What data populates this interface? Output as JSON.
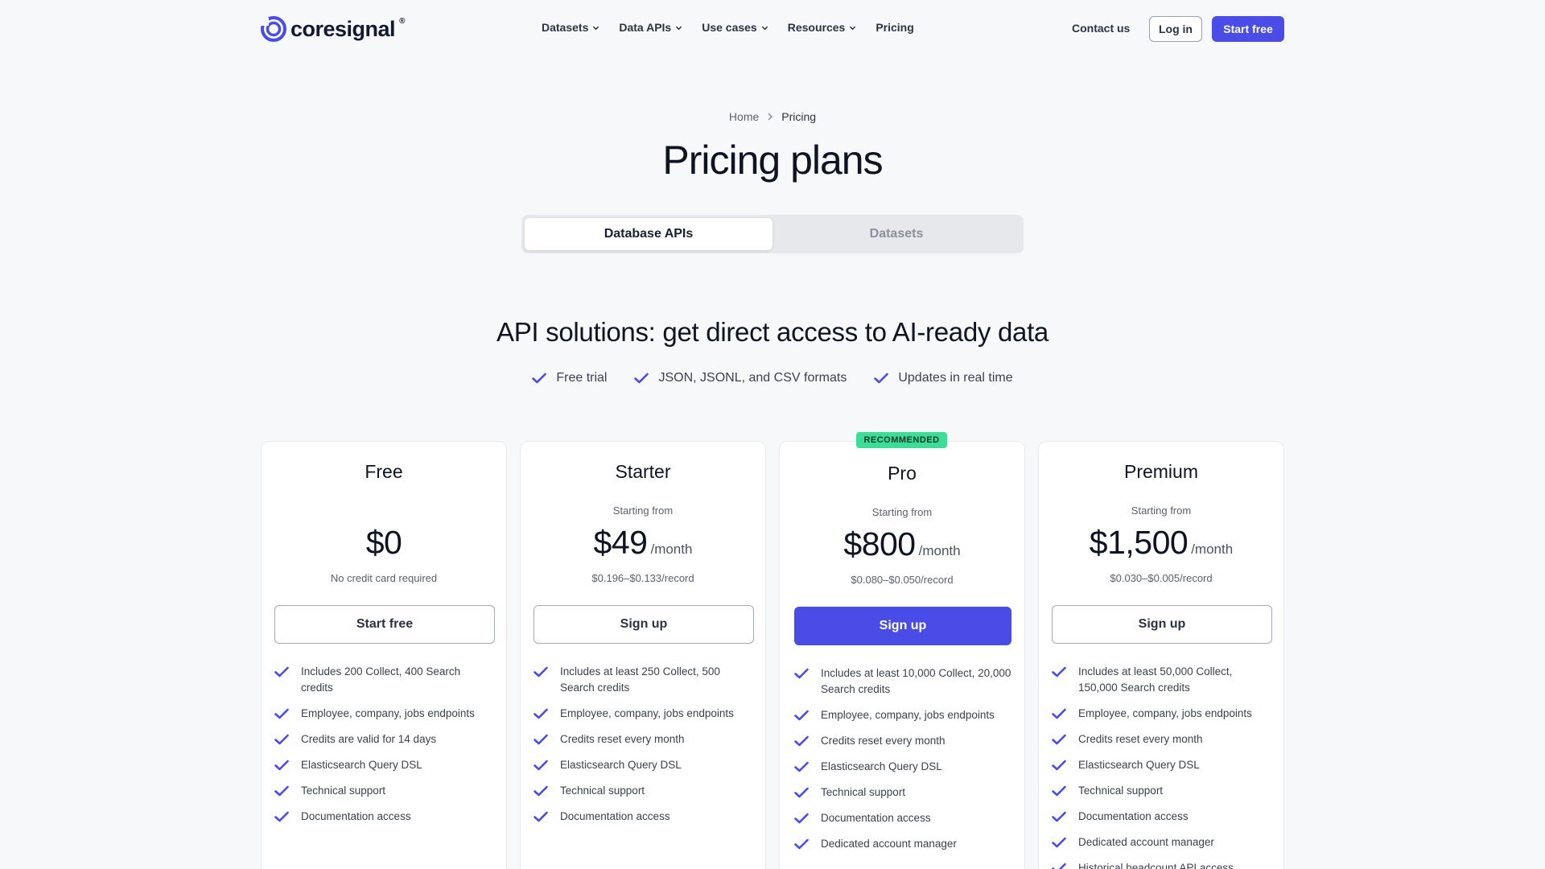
{
  "header": {
    "logo_text": "coresignal",
    "logo_reg": "®",
    "nav": [
      {
        "label": "Datasets",
        "has_menu": true
      },
      {
        "label": "Data APIs",
        "has_menu": true
      },
      {
        "label": "Use cases",
        "has_menu": true
      },
      {
        "label": "Resources",
        "has_menu": true
      },
      {
        "label": "Pricing",
        "has_menu": false
      }
    ],
    "contact": "Contact us",
    "login": "Log in",
    "start_free": "Start free"
  },
  "breadcrumb": {
    "home": "Home",
    "current": "Pricing"
  },
  "title": "Pricing plans",
  "toggle": {
    "active": "Database APIs",
    "inactive": "Datasets"
  },
  "section": {
    "title": "API solutions: get direct access to AI-ready data",
    "features": [
      "Free trial",
      "JSON, JSONL, and CSV formats",
      "Updates in real time"
    ]
  },
  "colors": {
    "accent": "#4a4ce8",
    "badge": "#3ddc97",
    "check": "#4a4ce8"
  },
  "plans": [
    {
      "name": "Free",
      "starting": "",
      "price": "$0",
      "per": "",
      "note": "No credit card required",
      "button": "Start free",
      "bullets": [
        "Includes 200 Collect, 400 Search credits",
        "Employee, company, jobs endpoints",
        "Credits are valid for 14 days",
        "Elasticsearch Query DSL",
        "Technical support",
        "Documentation access"
      ]
    },
    {
      "name": "Starter",
      "starting": "Starting from",
      "price": "$49",
      "per": "/month",
      "note": "$0.196–$0.133/record",
      "button": "Sign up",
      "bullets": [
        "Includes at least 250 Collect, 500 Search credits",
        "Employee, company, jobs endpoints",
        "Credits reset every month",
        "Elasticsearch Query DSL",
        "Technical support",
        "Documentation access"
      ]
    },
    {
      "name": "Pro",
      "badge": "RECOMMENDED",
      "starting": "Starting from",
      "price": "$800",
      "per": "/month",
      "note": "$0.080–$0.050/record",
      "button": "Sign up",
      "bullets": [
        "Includes at least 10,000 Collect, 20,000 Search credits",
        "Employee, company, jobs endpoints",
        "Credits reset every month",
        "Elasticsearch Query DSL",
        "Technical support",
        "Documentation access",
        "Dedicated account manager"
      ]
    },
    {
      "name": "Premium",
      "starting": "Starting from",
      "price": "$1,500",
      "per": "/month",
      "note": "$0.030–$0.005/record",
      "button": "Sign up",
      "bullets": [
        "Includes at least 50,000 Collect, 150,000 Search credits",
        "Employee, company, jobs endpoints",
        "Credits reset every month",
        "Elasticsearch Query DSL",
        "Technical support",
        "Documentation access",
        "Dedicated account manager",
        "Historical headcount API access"
      ]
    }
  ]
}
